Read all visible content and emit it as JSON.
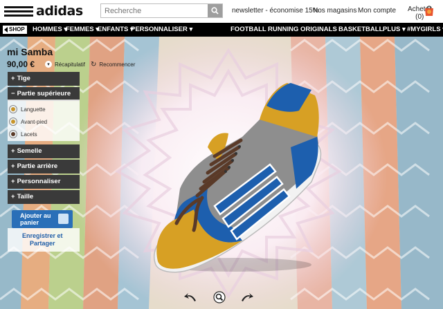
{
  "header": {
    "brand": "adidas",
    "search_placeholder": "Recherche",
    "links": [
      "newsletter - économise 15%",
      "Nos magasins",
      "Mon compte"
    ],
    "cart_label": "Acheter",
    "cart_count": "(0)"
  },
  "nav": {
    "shop": "SHOP",
    "left_items": [
      "HOMMES ▾",
      "FEMMES ▾",
      "ENFANTS ▾",
      "PERSONNALISER ▾"
    ],
    "right_items": [
      "FOOTBALL",
      "RUNNING",
      "ORIGINALS",
      "BASKETBALL",
      "PLUS ▾",
      "#MYGIRLS ▾"
    ]
  },
  "product": {
    "title": "mi Samba",
    "price": "90,00 €",
    "recap_label": "Récapitulatif",
    "restart_label": "Recommencer"
  },
  "panel": {
    "tige": "Tige",
    "partie_superieure": "Partie supérieure",
    "swatches": [
      {
        "label": "Languette",
        "color": "#c8952a"
      },
      {
        "label": "Avant-pied",
        "color": "#c8952a"
      },
      {
        "label": "Lacets",
        "color": "#5a3a28"
      }
    ],
    "semelle": "Semelle",
    "partie_arriere": "Partie arrière",
    "personnaliser": "Personnaliser",
    "taille": "Taille",
    "plus_sign": "+",
    "minus_sign": "−"
  },
  "actions": {
    "add_to_cart_line1": "Ajouter au",
    "add_to_cart_line2": "panier",
    "share_line1": "Enregistrer et",
    "share_line2": "Partager"
  },
  "colors": {
    "nav_bg": "#000000",
    "panel_bg": "#3a3a3a",
    "cta_blue": "#2a6fb8",
    "shoe_yellow": "#d9a22a",
    "shoe_blue": "#1d5fae",
    "shoe_grey": "#8c8c8c"
  }
}
